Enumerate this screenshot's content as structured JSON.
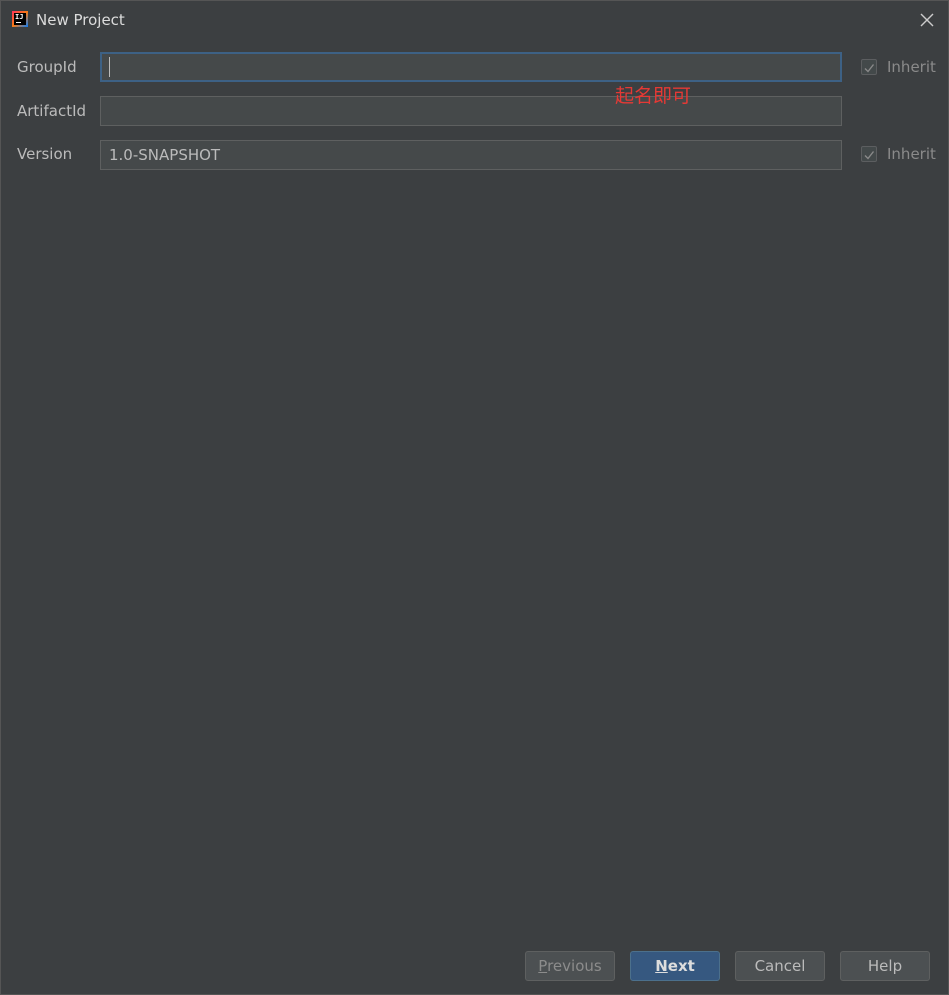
{
  "window": {
    "title": "New Project",
    "app_icon": "intellij-idea-icon",
    "close_icon": "close-icon"
  },
  "form": {
    "group_id": {
      "label": "GroupId",
      "value": "",
      "inherit_label": "Inherit",
      "inherit_checked": true
    },
    "artifact_id": {
      "label": "ArtifactId",
      "value": ""
    },
    "version": {
      "label": "Version",
      "value": "1.0-SNAPSHOT",
      "inherit_label": "Inherit",
      "inherit_checked": true
    }
  },
  "annotation": {
    "text": "起名即可",
    "color": "#e53935"
  },
  "buttons": {
    "previous": {
      "mnemonic": "P",
      "rest": "revious"
    },
    "next": {
      "mnemonic": "N",
      "rest": "ext"
    },
    "cancel": "Cancel",
    "help": "Help"
  },
  "colors": {
    "background": "#3c3f41",
    "field_background": "#45494a",
    "focus_border": "#3d6185",
    "primary_button": "#365880"
  }
}
